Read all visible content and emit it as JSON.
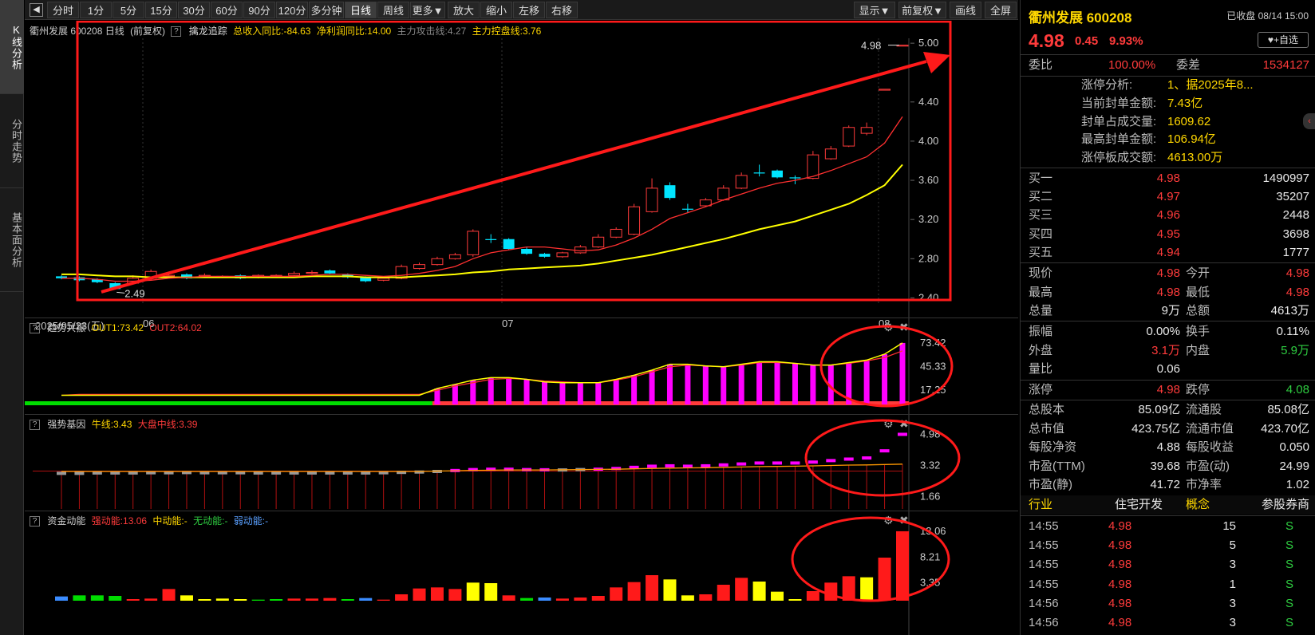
{
  "toolbar": {
    "periods": [
      "分时",
      "1分",
      "5分",
      "15分",
      "30分",
      "60分",
      "90分",
      "120分",
      "多分钟",
      "日线",
      "周线",
      "更多▼"
    ],
    "active_period": "日线",
    "actions": [
      "放大",
      "缩小",
      "左移",
      "右移"
    ],
    "right": [
      "显示▼",
      "前复权▼",
      "画线",
      "全屏"
    ]
  },
  "vtabs": [
    "K线分析",
    "分时走势",
    "基本面分析"
  ],
  "main_chart": {
    "header_name": "衢州发展 600208 日线",
    "adjust": "(前复权)",
    "indicator": "擒龙追踪",
    "revenue_yoy": "总收入同比:-84.63",
    "profit_yoy": "净利润同比:14.00",
    "attack_line": "主力攻击线:4.27",
    "control_line": "主力控盘线:3.76",
    "y_ticks": [
      "5.00",
      "4.40",
      "4.00",
      "3.60",
      "3.20",
      "2.80",
      "2.40"
    ],
    "x_labels": [
      "2025/05/23(五)",
      "06",
      "07",
      "08"
    ],
    "high_label": "4.98",
    "low_label": "2.49"
  },
  "chart_data": [
    {
      "type": "candlestick",
      "title": "衢州发展 600208 日线",
      "ylim": [
        2.33,
        5.05
      ],
      "x_start": "2025/05/23",
      "x_labels": [
        "06",
        "07",
        "08"
      ],
      "candles": [
        [
          2.62,
          2.6,
          2.63,
          2.59
        ],
        [
          2.61,
          2.58,
          2.62,
          2.57
        ],
        [
          2.59,
          2.56,
          2.6,
          2.55
        ],
        [
          2.55,
          2.49,
          2.56,
          2.49
        ],
        [
          2.55,
          2.6,
          2.63,
          2.54
        ],
        [
          2.6,
          2.67,
          2.69,
          2.59
        ],
        [
          2.62,
          2.63,
          2.64,
          2.6
        ],
        [
          2.64,
          2.6,
          2.65,
          2.59
        ],
        [
          2.63,
          2.63,
          2.65,
          2.61
        ],
        [
          2.62,
          2.62,
          2.63,
          2.61
        ],
        [
          2.63,
          2.6,
          2.64,
          2.59
        ],
        [
          2.61,
          2.63,
          2.64,
          2.6
        ],
        [
          2.63,
          2.63,
          2.64,
          2.61
        ],
        [
          2.63,
          2.65,
          2.67,
          2.62
        ],
        [
          2.65,
          2.66,
          2.68,
          2.64
        ],
        [
          2.68,
          2.65,
          2.69,
          2.64
        ],
        [
          2.64,
          2.61,
          2.65,
          2.6
        ],
        [
          2.61,
          2.57,
          2.62,
          2.56
        ],
        [
          2.58,
          2.6,
          2.61,
          2.57
        ],
        [
          2.6,
          2.72,
          2.74,
          2.59
        ],
        [
          2.7,
          2.74,
          2.76,
          2.69
        ],
        [
          2.74,
          2.8,
          2.82,
          2.73
        ],
        [
          2.8,
          2.84,
          2.86,
          2.79
        ],
        [
          2.84,
          3.08,
          3.1,
          2.82
        ],
        [
          3.0,
          2.99,
          3.05,
          2.96
        ],
        [
          3.0,
          2.9,
          3.01,
          2.89
        ],
        [
          2.9,
          2.85,
          2.92,
          2.84
        ],
        [
          2.85,
          2.82,
          2.86,
          2.81
        ],
        [
          2.82,
          2.86,
          2.87,
          2.81
        ],
        [
          2.86,
          2.92,
          2.94,
          2.85
        ],
        [
          2.92,
          3.02,
          3.05,
          2.91
        ],
        [
          3.02,
          3.1,
          3.12,
          3.01
        ],
        [
          3.05,
          3.33,
          3.36,
          3.04
        ],
        [
          3.28,
          3.52,
          3.62,
          3.27
        ],
        [
          3.55,
          3.42,
          3.58,
          3.4
        ],
        [
          3.31,
          3.3,
          3.36,
          3.27
        ],
        [
          3.34,
          3.4,
          3.42,
          3.33
        ],
        [
          3.4,
          3.52,
          3.55,
          3.39
        ],
        [
          3.52,
          3.65,
          3.68,
          3.51
        ],
        [
          3.68,
          3.67,
          3.76,
          3.64
        ],
        [
          3.7,
          3.63,
          3.71,
          3.62
        ],
        [
          3.63,
          3.62,
          3.65,
          3.56
        ],
        [
          3.62,
          3.86,
          3.9,
          3.61
        ],
        [
          3.82,
          3.92,
          3.95,
          3.81
        ],
        [
          3.95,
          4.14,
          4.16,
          3.94
        ],
        [
          4.08,
          4.14,
          4.19,
          4.06
        ],
        [
          4.53,
          4.53,
          4.53,
          4.53
        ],
        [
          4.98,
          4.98,
          4.98,
          4.98
        ]
      ],
      "ma_short": [
        2.6,
        2.6,
        2.59,
        2.57,
        2.57,
        2.58,
        2.6,
        2.61,
        2.62,
        2.62,
        2.62,
        2.62,
        2.62,
        2.62,
        2.63,
        2.64,
        2.64,
        2.63,
        2.62,
        2.63,
        2.65,
        2.68,
        2.72,
        2.8,
        2.86,
        2.89,
        2.92,
        2.92,
        2.9,
        2.88,
        2.89,
        2.94,
        3.01,
        3.1,
        3.21,
        3.27,
        3.33,
        3.4,
        3.46,
        3.52,
        3.57,
        3.6,
        3.64,
        3.7,
        3.77,
        3.84,
        3.98,
        4.25
      ],
      "ma_long": [
        2.64,
        2.64,
        2.63,
        2.62,
        2.62,
        2.61,
        2.61,
        2.61,
        2.61,
        2.61,
        2.61,
        2.61,
        2.61,
        2.61,
        2.62,
        2.62,
        2.62,
        2.61,
        2.61,
        2.61,
        2.62,
        2.63,
        2.64,
        2.66,
        2.67,
        2.69,
        2.7,
        2.71,
        2.72,
        2.73,
        2.75,
        2.78,
        2.81,
        2.84,
        2.88,
        2.92,
        2.96,
        3.0,
        3.05,
        3.1,
        3.14,
        3.18,
        3.24,
        3.3,
        3.36,
        3.45,
        3.55,
        3.76
      ]
    },
    {
      "type": "bar",
      "title": "趋势共振",
      "series": [
        {
          "name": "OUT1",
          "values": [
            11,
            11,
            11,
            11,
            11,
            11,
            11,
            11,
            11,
            11,
            11,
            11,
            11,
            11,
            11,
            11,
            11,
            11,
            11,
            11,
            11,
            19,
            24,
            29,
            32,
            32,
            30,
            27,
            26,
            26,
            26,
            30,
            35,
            41,
            48,
            48,
            46,
            45,
            48,
            51,
            51,
            49,
            47,
            47,
            50,
            53,
            60,
            73.42
          ]
        },
        {
          "name": "OUT2",
          "values": [
            11,
            12,
            12,
            12,
            12,
            12,
            12,
            12,
            12,
            12,
            12,
            12,
            12,
            12,
            12,
            12,
            12,
            12,
            12,
            12,
            12,
            17,
            22,
            26,
            30,
            31,
            30,
            28,
            27,
            26,
            26,
            29,
            33,
            39,
            45,
            47,
            46,
            45,
            47,
            50,
            50,
            49,
            47,
            47,
            49,
            52,
            56,
            64.02
          ]
        }
      ],
      "y_ticks": [
        "73.42",
        "45.33",
        "17.25"
      ]
    },
    {
      "type": "bar",
      "title": "强势基因",
      "series": [
        {
          "name": "牛线",
          "values": [
            2.9,
            2.9,
            2.92,
            2.92,
            2.92,
            2.93,
            2.93,
            2.94,
            2.93,
            2.93,
            2.93,
            2.92,
            2.92,
            2.92,
            2.92,
            2.92,
            2.92,
            2.92,
            2.93,
            2.95,
            2.97,
            3.0,
            3.05,
            3.1,
            3.12,
            3.12,
            3.1,
            3.09,
            3.08,
            3.1,
            3.12,
            3.16,
            3.22,
            3.28,
            3.3,
            3.28,
            3.3,
            3.35,
            3.4,
            3.45,
            3.45,
            3.45,
            3.5,
            3.58,
            3.66,
            3.72,
            4.1,
            4.98
          ]
        },
        {
          "name": "大盘中线",
          "values": [
            3.0,
            3.0,
            3.0,
            3.0,
            3.0,
            3.0,
            3.0,
            3.0,
            3.0,
            3.0,
            3.0,
            3.0,
            3.0,
            3.0,
            3.0,
            3.0,
            3.0,
            3.0,
            3.0,
            3.0,
            3.0,
            3.02,
            3.04,
            3.06,
            3.07,
            3.08,
            3.08,
            3.08,
            3.09,
            3.1,
            3.11,
            3.12,
            3.14,
            3.16,
            3.18,
            3.19,
            3.2,
            3.22,
            3.24,
            3.26,
            3.27,
            3.28,
            3.3,
            3.32,
            3.34,
            3.35,
            3.37,
            3.39
          ]
        }
      ],
      "y_ticks": [
        "4.98",
        "3.32",
        "1.66"
      ]
    },
    {
      "type": "bar",
      "title": "资金动能",
      "categories_legend": [
        "强动能",
        "中动能",
        "无动能",
        "弱动能"
      ],
      "values": [
        0.8,
        1.0,
        1.0,
        0.9,
        0.3,
        0.4,
        2.2,
        1.0,
        0.3,
        0.4,
        0.3,
        0.2,
        0.3,
        0.4,
        0.4,
        0.5,
        0.3,
        0.5,
        0.2,
        1.2,
        2.3,
        2.5,
        2.2,
        3.4,
        3.3,
        1.0,
        0.5,
        0.6,
        0.4,
        0.6,
        0.9,
        2.5,
        3.5,
        4.8,
        4.0,
        1.0,
        1.2,
        3.0,
        4.3,
        3.6,
        1.7,
        0.3,
        1.8,
        3.4,
        4.6,
        4.4,
        8.1,
        13.06
      ],
      "kinds": [
        "b",
        "g",
        "g",
        "g",
        "r",
        "r",
        "r",
        "y",
        "y",
        "y",
        "y",
        "g",
        "g",
        "r",
        "r",
        "r",
        "g",
        "b",
        "r",
        "r",
        "r",
        "r",
        "r",
        "y",
        "y",
        "r",
        "g",
        "b",
        "r",
        "r",
        "r",
        "r",
        "r",
        "r",
        "y",
        "y",
        "r",
        "r",
        "r",
        "y",
        "y",
        "y",
        "r",
        "r",
        "r",
        "y",
        "r",
        "r"
      ],
      "y_ticks": [
        "13.06",
        "8.21",
        "3.35"
      ],
      "strong_value": "强动能:13.06",
      "mid_value": "中动能:-",
      "none_value": "无动能:-",
      "weak_value": "弱动能:-"
    }
  ],
  "sub_panels": {
    "trend_name": "趋势共振",
    "trend_out1": "OUT1:73.42",
    "trend_out2": "OUT2:64.02",
    "gene_name": "强势基因",
    "gene_bull": "牛线:3.43",
    "gene_market": "大盘中线:3.39",
    "fund_name": "资金动能",
    "fund_strong": "强动能:13.06",
    "fund_mid": "中动能:-",
    "fund_none": "无动能:-",
    "fund_weak": "弱动能:-"
  },
  "colors": {
    "up": "#ff3b3b",
    "down": "#00e5ff",
    "ma_short": "#ff3030",
    "ma_long": "#ffff00",
    "magenta": "#ff00ff",
    "green": "#00dd00"
  },
  "info": {
    "name": "衢州发展 600208",
    "status": "已收盘 08/14 15:00",
    "price": "4.98",
    "change": "0.45",
    "pct": "9.93%",
    "watch_btn": "+自选",
    "weibi_label": "委比",
    "weibi": "100.00%",
    "weicha_label": "委差",
    "weicha": "1534127",
    "limit_rows": [
      {
        "label": "涨停分析:",
        "value": "1、据2025年8..."
      },
      {
        "label": "当前封单金额:",
        "value": "7.43亿"
      },
      {
        "label": "封单占成交量:",
        "value": "1609.62"
      },
      {
        "label": "最高封单金额:",
        "value": "106.94亿"
      },
      {
        "label": "涨停板成交额:",
        "value": "4613.00万"
      }
    ],
    "bids": [
      {
        "label": "买一",
        "price": "4.98",
        "vol": "1490997"
      },
      {
        "label": "买二",
        "price": "4.97",
        "vol": "35207"
      },
      {
        "label": "买三",
        "price": "4.96",
        "vol": "2448"
      },
      {
        "label": "买四",
        "price": "4.95",
        "vol": "3698"
      },
      {
        "label": "买五",
        "price": "4.94",
        "vol": "1777"
      }
    ],
    "stats1": [
      {
        "l1": "现价",
        "v1": "4.98",
        "l2": "今开",
        "v2": "4.98"
      },
      {
        "l1": "最高",
        "v1": "4.98",
        "l2": "最低",
        "v2": "4.98"
      },
      {
        "l1": "总量",
        "v1": "9万",
        "l2": "总额",
        "v2": "4613万"
      }
    ],
    "stats2": [
      {
        "l1": "振幅",
        "v1": "0.00%",
        "l2": "换手",
        "v2": "0.11%"
      },
      {
        "l1": "外盘",
        "v1": "3.1万",
        "l2": "内盘",
        "v2": "5.9万"
      },
      {
        "l1": "量比",
        "v1": "0.06",
        "l2": "",
        "v2": ""
      }
    ],
    "limit_label": "涨停",
    "limit_up": "4.98",
    "limit_down_label": "跌停",
    "limit_down": "4.08",
    "stats3": [
      {
        "l1": "总股本",
        "v1": "85.09亿",
        "l2": "流通股",
        "v2": "85.08亿"
      },
      {
        "l1": "总市值",
        "v1": "423.75亿",
        "l2": "流通市值",
        "v2": "423.70亿"
      },
      {
        "l1": "每股净资",
        "v1": "4.88",
        "l2": "每股收益",
        "v2": "0.050"
      },
      {
        "l1": "市盈(TTM)",
        "v1": "39.68",
        "l2": "市盈(动)",
        "v2": "24.99"
      },
      {
        "l1": "市盈(静)",
        "v1": "41.72",
        "l2": "市净率",
        "v2": "1.02"
      }
    ],
    "industry_label": "行业",
    "industry": "住宅开发",
    "concept_label": "概念",
    "concept": "参股券商",
    "trades": [
      {
        "time": "14:55",
        "price": "4.98",
        "vol": "15",
        "side": "S"
      },
      {
        "time": "14:55",
        "price": "4.98",
        "vol": "5",
        "side": "S"
      },
      {
        "time": "14:55",
        "price": "4.98",
        "vol": "3",
        "side": "S"
      },
      {
        "time": "14:55",
        "price": "4.98",
        "vol": "1",
        "side": "S"
      },
      {
        "time": "14:56",
        "price": "4.98",
        "vol": "3",
        "side": "S"
      },
      {
        "time": "14:56",
        "price": "4.98",
        "vol": "3",
        "side": "S"
      }
    ]
  }
}
